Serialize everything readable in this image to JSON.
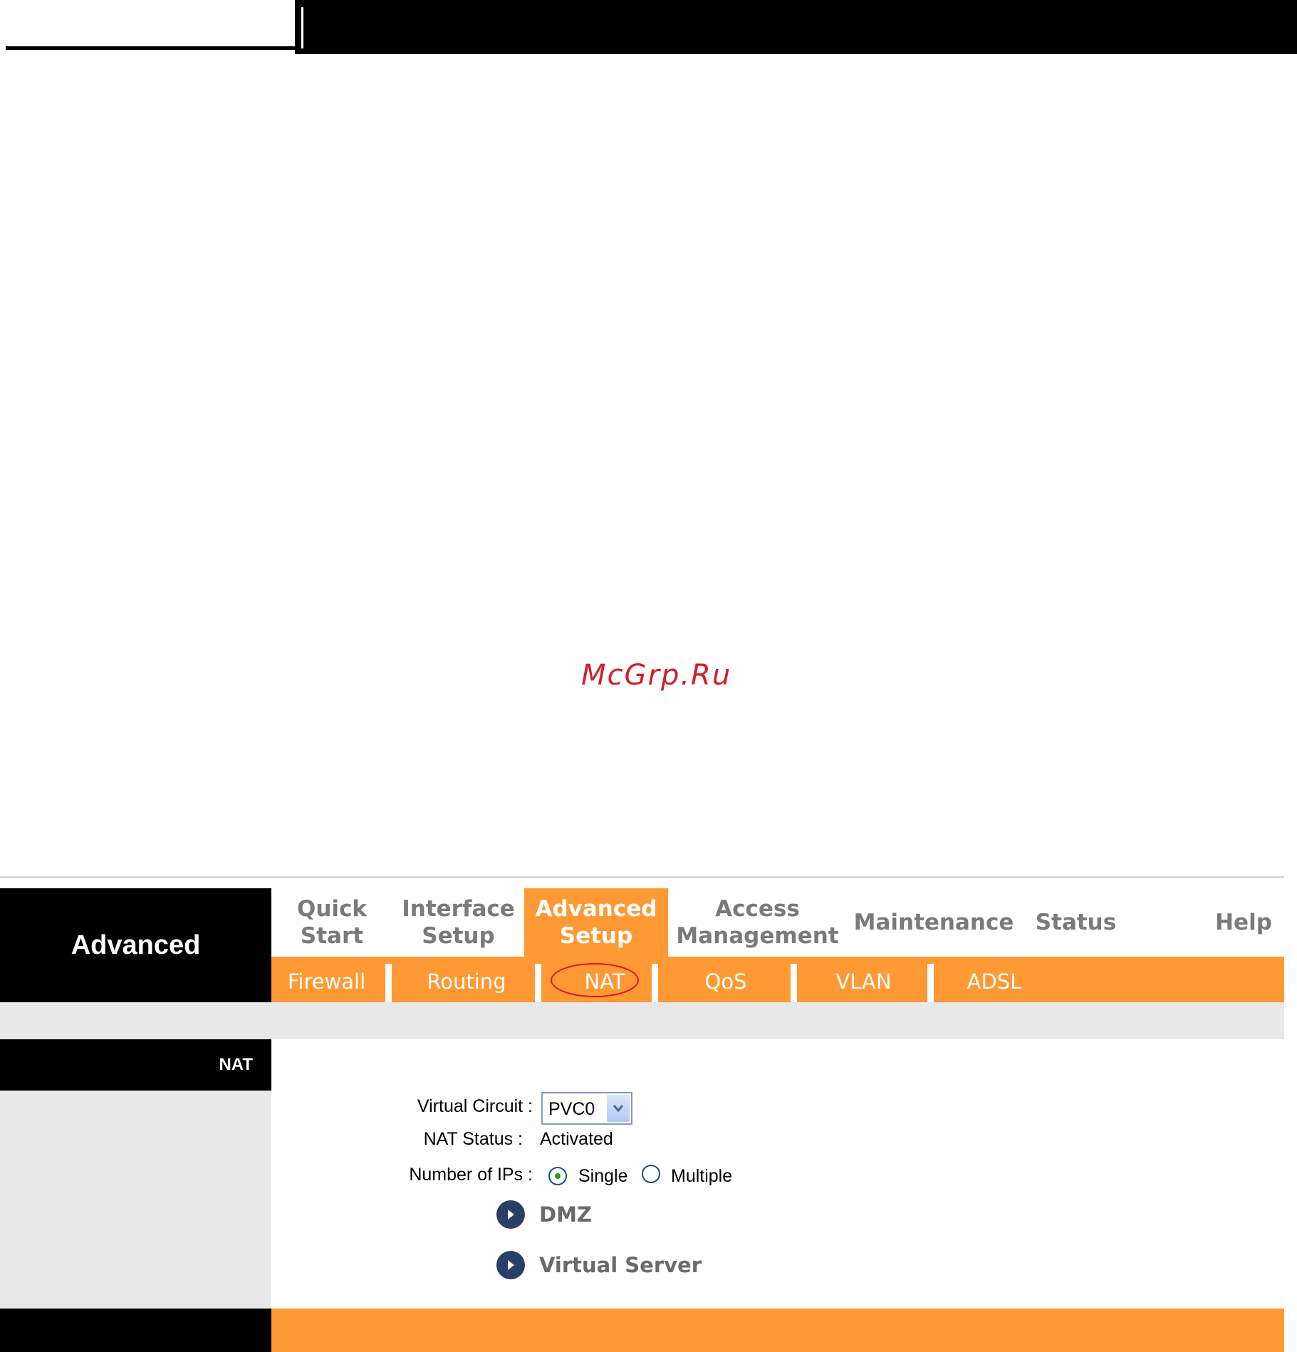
{
  "watermark": "McGrp.Ru",
  "brand": "Advanced",
  "main_nav": [
    {
      "line1": "Quick",
      "line2": "Start"
    },
    {
      "line1": "Interface",
      "line2": "Setup"
    },
    {
      "line1": "Advanced",
      "line2": "Setup"
    },
    {
      "line1": "Access",
      "line2": "Management"
    },
    {
      "line1": "Maintenance",
      "line2": ""
    },
    {
      "line1": "Status",
      "line2": ""
    },
    {
      "line1": "Help",
      "line2": ""
    }
  ],
  "active_main_tab": "Advanced Setup",
  "sub_nav": [
    "Firewall",
    "Routing",
    "NAT",
    "QoS",
    "VLAN",
    "ADSL"
  ],
  "active_sub_tab": "NAT",
  "section_title": "NAT",
  "form": {
    "virtual_circuit_label": "Virtual Circuit :",
    "virtual_circuit_value": "PVC0",
    "nat_status_label": "NAT Status :",
    "nat_status_value": "Activated",
    "number_of_ips_label": "Number of IPs :",
    "option_single": "Single",
    "option_multiple": "Multiple",
    "selected_option": "Single"
  },
  "links": [
    "DMZ",
    "Virtual Server"
  ],
  "colors": {
    "accent_orange": "#ff9933",
    "highlight_ellipse": "#e0101a"
  }
}
